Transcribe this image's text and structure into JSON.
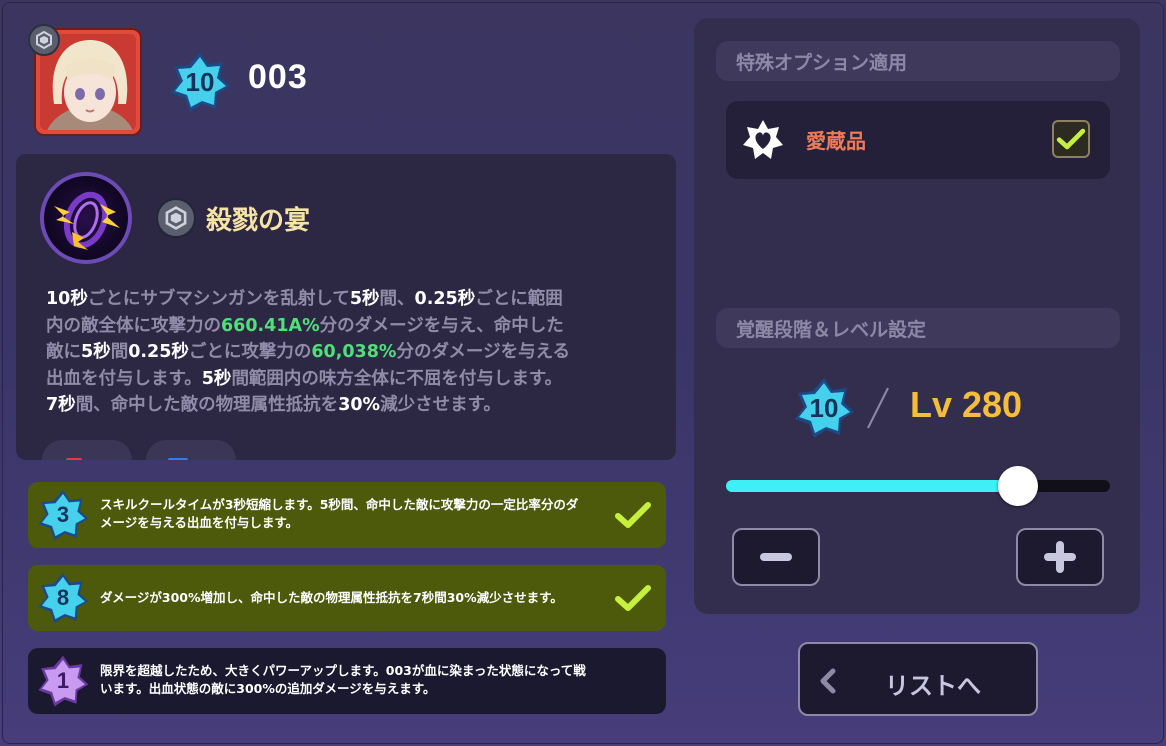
{
  "hero": {
    "level": "10",
    "name": "003",
    "portrait": "hero-portrait-blonde-girl",
    "rank_icon": "silver-rank-icon"
  },
  "skill": {
    "title": "殺戮の宴",
    "icon": "purple-vortex-skill-icon",
    "rank_icon": "silver-rank-icon",
    "description": [
      [
        {
          "t": "10秒",
          "c": "w"
        },
        {
          "t": "ごとにサブマシンガンを乱射して",
          "c": "d"
        },
        {
          "t": "5秒",
          "c": "w"
        },
        {
          "t": "間、",
          "c": "d"
        },
        {
          "t": "0.25秒",
          "c": "w"
        },
        {
          "t": "ごとに範囲",
          "c": "d"
        }
      ],
      [
        {
          "t": "内の敵全体に攻撃力の",
          "c": "d"
        },
        {
          "t": "660.41A%",
          "c": "g"
        },
        {
          "t": "分のダメージを与え、命中した",
          "c": "d"
        }
      ],
      [
        {
          "t": "敵に",
          "c": "d"
        },
        {
          "t": "5秒",
          "c": "w"
        },
        {
          "t": "間",
          "c": "d"
        },
        {
          "t": "0.25秒",
          "c": "w"
        },
        {
          "t": "ごとに攻撃力の",
          "c": "d"
        },
        {
          "t": "60,038%",
          "c": "g"
        },
        {
          "t": "分のダメージを与える",
          "c": "d"
        }
      ],
      [
        {
          "t": "出血を付与します。",
          "c": "d"
        },
        {
          "t": "5秒",
          "c": "w"
        },
        {
          "t": "間範囲内の味方全体に不屈を付与します。",
          "c": "d"
        }
      ],
      [
        {
          "t": "7秒",
          "c": "w"
        },
        {
          "t": "間、命中した敵の物理属性抵抗を",
          "c": "d"
        },
        {
          "t": "30%",
          "c": "w"
        },
        {
          "t": "減少させます。",
          "c": "d"
        }
      ]
    ],
    "tags": [
      {
        "name": "red-tag",
        "color": "#e23a4a"
      },
      {
        "name": "blue-tag",
        "color": "#3a7ae2"
      }
    ]
  },
  "enhancements": [
    {
      "level": "3",
      "text": [
        "スキルクールタイムが3秒短縮します。5秒間、命中した敵に攻撃力の一定比率分のダ",
        "メージを与える出血を付与します。"
      ],
      "active": true,
      "star_color": "#45d0ec"
    },
    {
      "level": "8",
      "text": [
        "ダメージが300%増加し、命中した敵の物理属性抵抗を7秒間30%減少させます。"
      ],
      "active": true,
      "star_color": "#45d0ec"
    },
    {
      "level": "1",
      "text": [
        "限界を超越したため、大きくパワーアップします。003が血に染まった状態になって戦",
        "います。出血状態の敵に300%の追加ダメージを与えます。"
      ],
      "active": false,
      "star_color": "#c89af0"
    }
  ],
  "special_option": {
    "header": "特殊オプション適用",
    "item_label": "愛蔵品",
    "item_icon": "star-heart-icon",
    "checked": true
  },
  "awakening": {
    "header": "覚醒段階＆レベル設定",
    "stage": "10",
    "level_text": "Lv 280",
    "slider_fraction": 0.76
  },
  "buttons": {
    "list_label": "リストへ"
  },
  "colors": {
    "accent_cyan": "#3ef0f5",
    "level_gold": "#f4bd3c",
    "active_row": "#4d5a0c",
    "check_green": "#c6f03c"
  }
}
